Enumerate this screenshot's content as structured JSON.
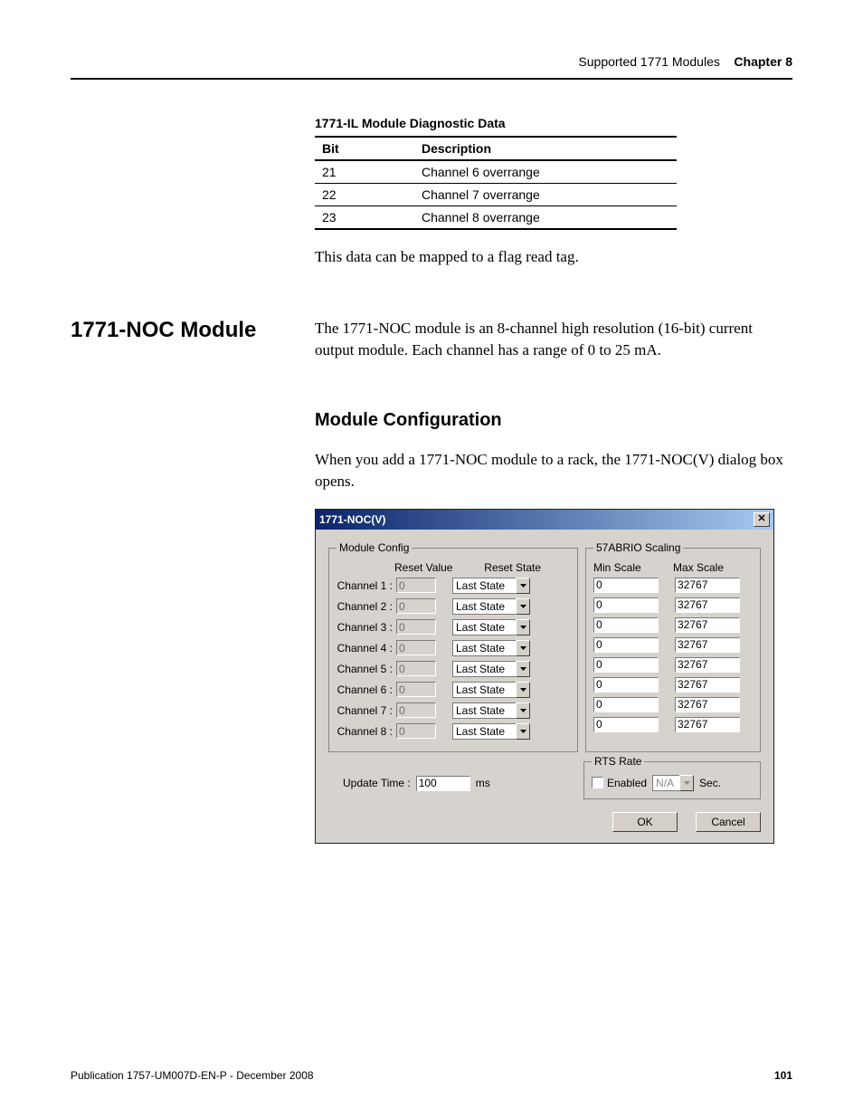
{
  "header": {
    "subject": "Supported 1771 Modules",
    "chapter": "Chapter 8"
  },
  "diag_table": {
    "title": "1771-IL Module Diagnostic Data",
    "col_bit": "Bit",
    "col_desc": "Description",
    "rows": [
      {
        "bit": "21",
        "desc": "Channel 6 overrange"
      },
      {
        "bit": "22",
        "desc": "Channel 7 overrange"
      },
      {
        "bit": "23",
        "desc": "Channel 8 overrange"
      }
    ]
  },
  "para1": "This data can be mapped to a flag read tag.",
  "section": {
    "sidebar": "1771-NOC Module",
    "intro": "The 1771-NOC module is an 8-channel high resolution (16-bit) current output module. Each channel has a range of 0 to 25 mA.",
    "sub": "Module Configuration",
    "sub_para": "When you add a 1771-NOC module to a rack, the 1771-NOC(V) dialog box opens."
  },
  "dialog": {
    "title": "1771-NOC(V)",
    "close_glyph": "✕",
    "module_config_legend": "Module Config",
    "reset_value_label": "Reset Value",
    "reset_state_label": "Reset State",
    "scaling_legend": "57ABRIO Scaling",
    "min_scale_label": "Min Scale",
    "max_scale_label": "Max Scale",
    "channels": [
      {
        "label": "Channel 1 :",
        "reset_value": "0",
        "reset_state": "Last State",
        "min": "0",
        "max": "32767"
      },
      {
        "label": "Channel 2 :",
        "reset_value": "0",
        "reset_state": "Last State",
        "min": "0",
        "max": "32767"
      },
      {
        "label": "Channel 3 :",
        "reset_value": "0",
        "reset_state": "Last State",
        "min": "0",
        "max": "32767"
      },
      {
        "label": "Channel 4 :",
        "reset_value": "0",
        "reset_state": "Last State",
        "min": "0",
        "max": "32767"
      },
      {
        "label": "Channel 5 :",
        "reset_value": "0",
        "reset_state": "Last State",
        "min": "0",
        "max": "32767"
      },
      {
        "label": "Channel 6 :",
        "reset_value": "0",
        "reset_state": "Last State",
        "min": "0",
        "max": "32767"
      },
      {
        "label": "Channel 7 :",
        "reset_value": "0",
        "reset_state": "Last State",
        "min": "0",
        "max": "32767"
      },
      {
        "label": "Channel 8 :",
        "reset_value": "0",
        "reset_state": "Last State",
        "min": "0",
        "max": "32767"
      }
    ],
    "update_time_label": "Update Time :",
    "update_time_value": "100",
    "update_time_unit": "ms",
    "rts_legend": "RTS Rate",
    "rts_enabled_label": "Enabled",
    "rts_value": "N/A",
    "rts_unit": "Sec.",
    "ok": "OK",
    "cancel": "Cancel"
  },
  "footer": {
    "pub": "Publication 1757-UM007D-EN-P - December 2008",
    "page": "101"
  }
}
